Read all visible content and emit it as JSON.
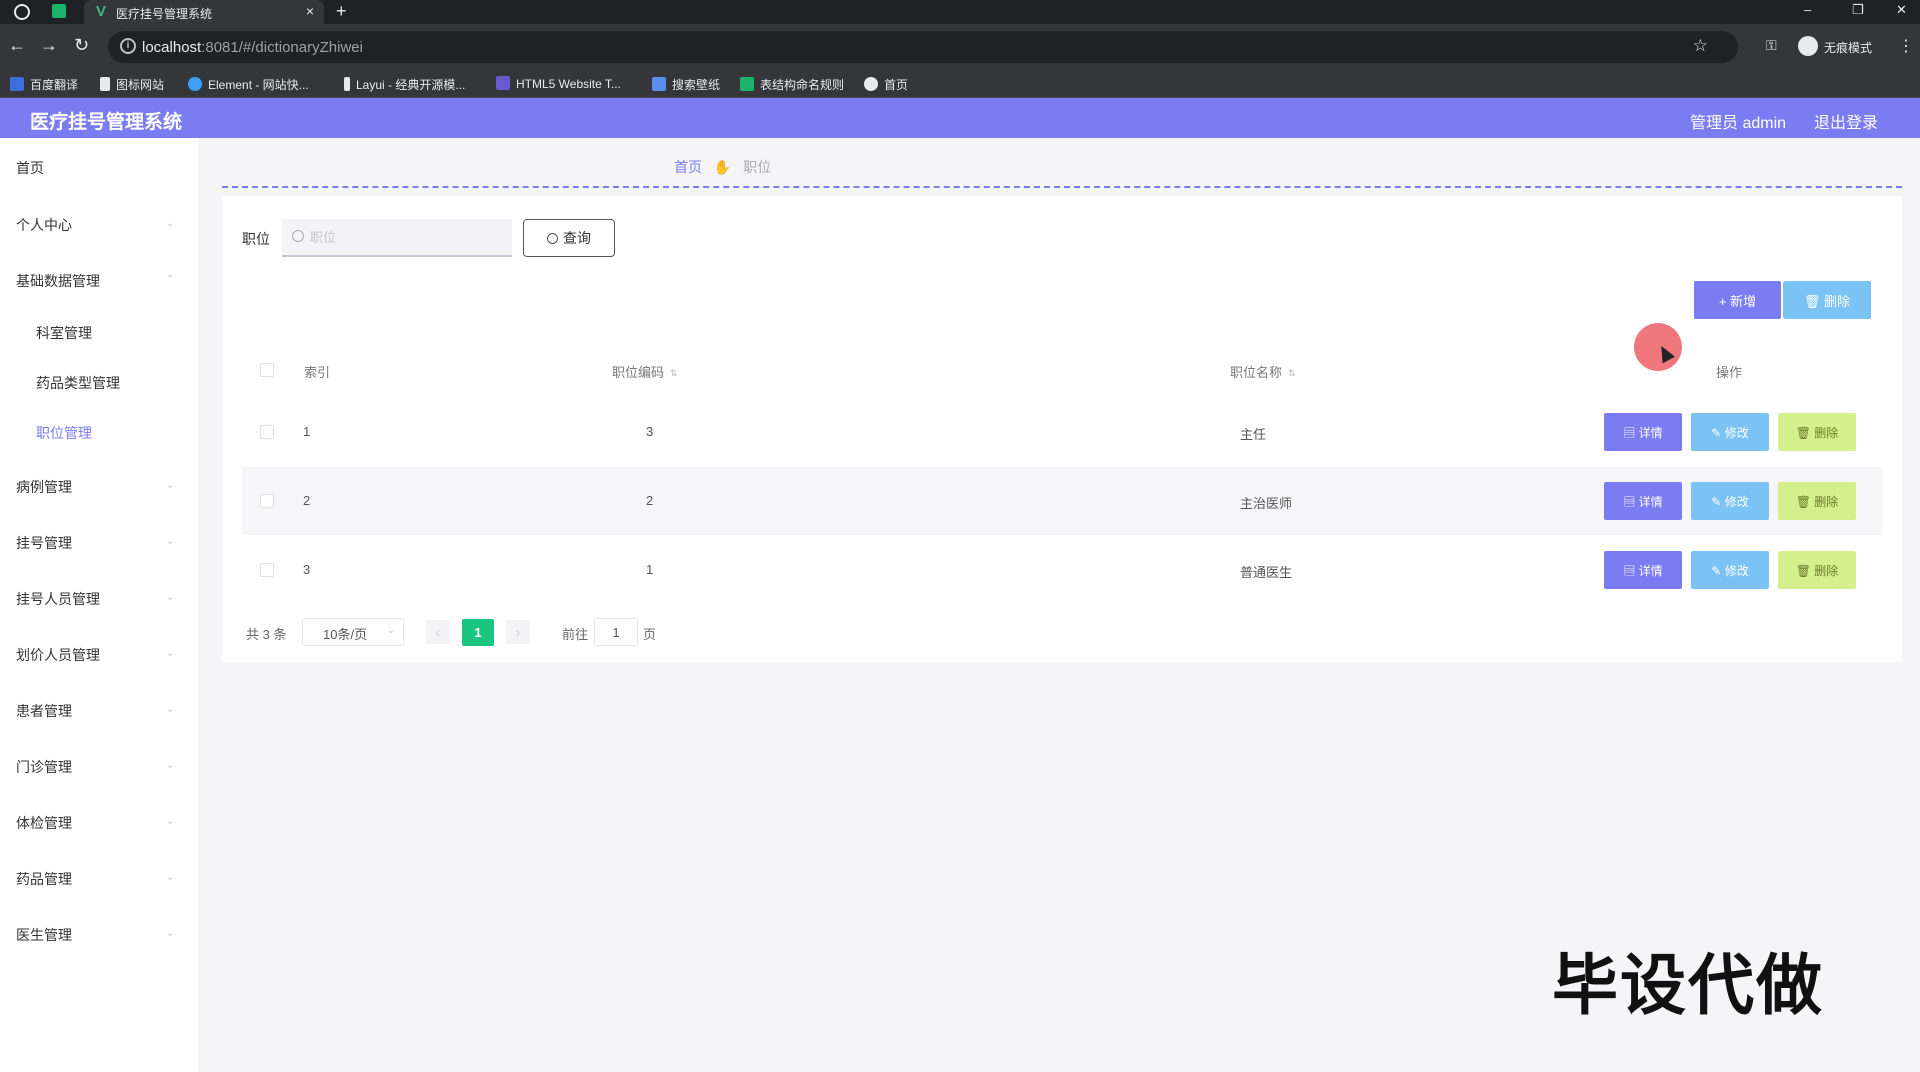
{
  "browser": {
    "tab_title": "医疗挂号管理系统",
    "tab_close": "×",
    "new_tab": "+",
    "url_host": "localhost",
    "url_path": ":8081/#/dictionaryZhiwei",
    "incognito_label": "无痕模式",
    "window_controls": {
      "minimize": "–",
      "restore": "❐",
      "close": "✕"
    },
    "nav": {
      "back": "←",
      "forward": "→",
      "reload": "↻"
    },
    "bookmarks": [
      {
        "label": "百度翻译",
        "color": "#3d6ee0"
      },
      {
        "label": "图标网站",
        "color": "#e8eaed"
      },
      {
        "label": "Element - 网站快...",
        "color": "#409eff"
      },
      {
        "label": "Layui - 经典开源模...",
        "color": "#e8eaed"
      },
      {
        "label": "HTML5 Website T...",
        "color": "#6a5acd"
      },
      {
        "label": "搜索壁纸",
        "color": "#5b8def"
      },
      {
        "label": "表结构命名规则",
        "color": "#1db36b"
      },
      {
        "label": "首页",
        "color": "#e8eaed"
      }
    ]
  },
  "header": {
    "title": "医疗挂号管理系统",
    "admin": "管理员 admin",
    "logout": "退出登录"
  },
  "sidebar": {
    "items": [
      {
        "label": "首页"
      },
      {
        "label": "个人中心"
      },
      {
        "label": "基础数据管理"
      },
      {
        "label": "病例管理"
      },
      {
        "label": "挂号管理"
      },
      {
        "label": "挂号人员管理"
      },
      {
        "label": "划价人员管理"
      },
      {
        "label": "患者管理"
      },
      {
        "label": "门诊管理"
      },
      {
        "label": "体检管理"
      },
      {
        "label": "药品管理"
      },
      {
        "label": "医生管理"
      }
    ],
    "submenu": [
      {
        "label": "科室管理"
      },
      {
        "label": "药品类型管理"
      },
      {
        "label": "职位管理"
      }
    ]
  },
  "breadcrumb": {
    "home": "首页",
    "current": "职位"
  },
  "filter": {
    "label": "职位",
    "placeholder": "职位",
    "query_button": "查询"
  },
  "toolbar": {
    "add": "+ 新增",
    "delete": "删除"
  },
  "table": {
    "headers": {
      "index": "索引",
      "code": "职位编码",
      "name": "职位名称",
      "actions": "操作"
    },
    "rows": [
      {
        "index": "1",
        "code": "3",
        "name": "主任"
      },
      {
        "index": "2",
        "code": "2",
        "name": "主治医师"
      },
      {
        "index": "3",
        "code": "1",
        "name": "普通医生"
      }
    ],
    "row_actions": {
      "detail": "详情",
      "edit": "修改",
      "delete": "删除"
    }
  },
  "pagination": {
    "total": "共 3 条",
    "page_size": "10条/页",
    "current_page": "1",
    "goto_label": "前往",
    "goto_value": "1",
    "page_suffix": "页"
  },
  "watermark": "毕设代做",
  "colors": {
    "brand": "#7b7cf2",
    "accent_blue": "#7cc3f5",
    "accent_green": "#d4f08c",
    "page_active": "#19c57f"
  }
}
